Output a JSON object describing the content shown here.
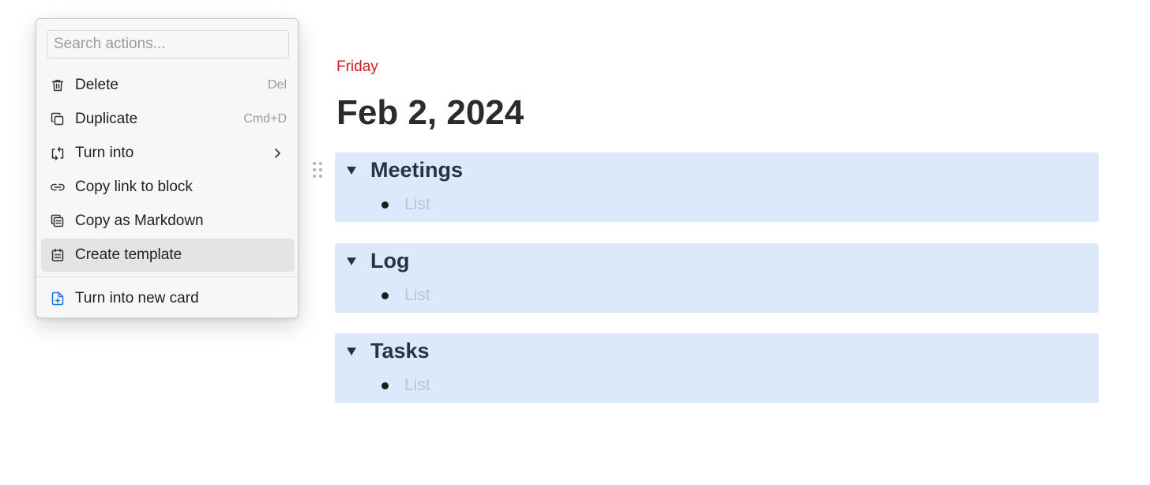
{
  "menu": {
    "search_placeholder": "Search actions...",
    "items": [
      {
        "label": "Delete",
        "shortcut": "Del",
        "icon": "trash-icon"
      },
      {
        "label": "Duplicate",
        "shortcut": "Cmd+D",
        "icon": "duplicate-icon"
      },
      {
        "label": "Turn into",
        "icon": "convert-icon",
        "submenu": true
      },
      {
        "label": "Copy link to block",
        "icon": "link-icon"
      },
      {
        "label": "Copy as Markdown",
        "icon": "copy-markdown-icon"
      },
      {
        "label": "Create template",
        "icon": "template-icon",
        "highlighted": true
      },
      {
        "label": "Turn into new card",
        "icon": "new-card-icon",
        "icon_color": "#1a73e8"
      }
    ]
  },
  "page": {
    "day": "Friday",
    "title": "Feb 2, 2024",
    "day_color": "#d21d1d",
    "block_color": "#dce9fa",
    "blocks": [
      {
        "heading": "Meetings",
        "placeholder": "List"
      },
      {
        "heading": "Log",
        "placeholder": "List"
      },
      {
        "heading": "Tasks",
        "placeholder": "List"
      }
    ]
  }
}
